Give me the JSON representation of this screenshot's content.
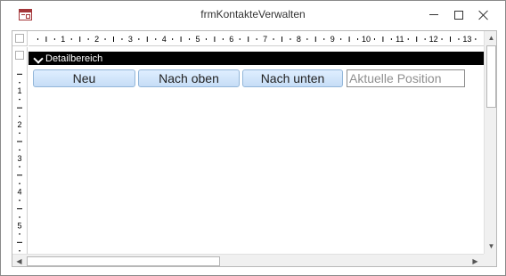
{
  "window": {
    "title": "frmKontakteVerwalten",
    "icon": "access-form-icon",
    "controls": [
      "minimize-icon",
      "maximize-icon",
      "close-icon"
    ]
  },
  "ruler": {
    "horizontal_numbers": [
      "1",
      "2",
      "3",
      "4",
      "5",
      "6",
      "7",
      "8",
      "9",
      "10",
      "11",
      "12",
      "13"
    ],
    "vertical_numbers": [
      "1",
      "2",
      "3",
      "4",
      "5"
    ]
  },
  "section": {
    "label": "Detailbereich"
  },
  "buttons": {
    "neu": "Neu",
    "nach_oben": "Nach oben",
    "nach_unten": "Nach unten"
  },
  "position_field": {
    "value": "Aktuelle Position"
  },
  "scrollbars": {
    "up_arrow": "▲",
    "down_arrow": "▼",
    "left_arrow": "◀",
    "right_arrow": "▶"
  }
}
